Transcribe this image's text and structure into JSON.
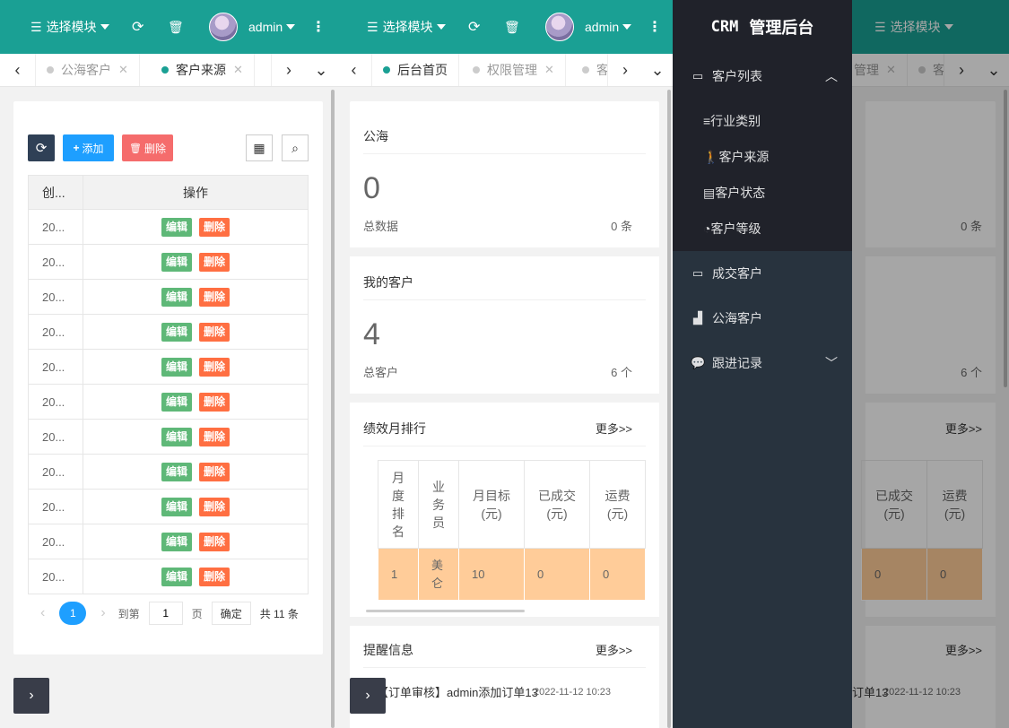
{
  "topbar": {
    "module_label": "选择模块",
    "user_name": "admin"
  },
  "panel1": {
    "tabs": [
      {
        "label": "公海客户",
        "active": false
      },
      {
        "label": "客户来源",
        "active": true
      }
    ],
    "toolbar": {
      "add_label": "添加",
      "delete_label": "删除"
    },
    "table": {
      "columns": [
        "创...",
        "操作"
      ],
      "rows": [
        {
          "date": "20...",
          "edit": "编辑",
          "del": "删除"
        },
        {
          "date": "20...",
          "edit": "编辑",
          "del": "删除"
        },
        {
          "date": "20...",
          "edit": "编辑",
          "del": "删除"
        },
        {
          "date": "20...",
          "edit": "编辑",
          "del": "删除"
        },
        {
          "date": "20...",
          "edit": "编辑",
          "del": "删除"
        },
        {
          "date": "20...",
          "edit": "编辑",
          "del": "删除"
        },
        {
          "date": "20...",
          "edit": "编辑",
          "del": "删除"
        },
        {
          "date": "20...",
          "edit": "编辑",
          "del": "删除"
        },
        {
          "date": "20...",
          "edit": "编辑",
          "del": "删除"
        },
        {
          "date": "20...",
          "edit": "编辑",
          "del": "删除"
        },
        {
          "date": "20...",
          "edit": "编辑",
          "del": "删除"
        }
      ]
    },
    "pager": {
      "current_page": "1",
      "goto_label": "到第",
      "goto_value": "1",
      "page_label": "页",
      "confirm_label": "确定",
      "total_label": "共 11 条"
    }
  },
  "panel2": {
    "tabs": [
      {
        "label": "后台首页",
        "active": true
      },
      {
        "label": "权限管理",
        "active": false
      },
      {
        "label": "客",
        "active": false
      }
    ],
    "sea": {
      "title": "公海",
      "count": "0",
      "total_label": "总数据",
      "unit_value": "0 条"
    },
    "mine": {
      "title": "我的客户",
      "count": "4",
      "total_label": "总客户",
      "unit_value": "6 个"
    },
    "ranking": {
      "title": "绩效月排行",
      "more": "更多>>",
      "headers": [
        "月度排名",
        "业务员",
        "月目标(元)",
        "已成交(元)",
        "运费(元)"
      ],
      "rows": [
        {
          "rank": "1",
          "name": "美仑",
          "target": "10",
          "done": "0",
          "freight": "0"
        }
      ]
    },
    "reminder": {
      "title": "提醒信息",
      "more": "更多>>",
      "item_text": "【订单审核】admin添加订单13",
      "item_time": "2022-11-12 10:23"
    }
  },
  "panel3": {
    "logo_prefix": "CRM",
    "logo_title": "管理后台",
    "tabs": [
      {
        "label": "管理",
        "active": false
      },
      {
        "label": "客",
        "active": false
      }
    ],
    "menu": {
      "customer_list": "客户列表",
      "sub_items": [
        "行业类别",
        "客户来源",
        "客户状态",
        "客户等级"
      ],
      "deal_customers": "成交客户",
      "sea_customers": "公海客户",
      "follow_records": "跟进记录"
    },
    "bg": {
      "sea_unit": "0 条",
      "mine_unit": "6 个",
      "more1": "更多>>",
      "headers": [
        "已成交(元)",
        "运费(元)"
      ],
      "done": "0",
      "freight": "0",
      "more2": "更多>>",
      "item_text": "订单13",
      "item_time": "2022-11-12 10:23"
    }
  }
}
